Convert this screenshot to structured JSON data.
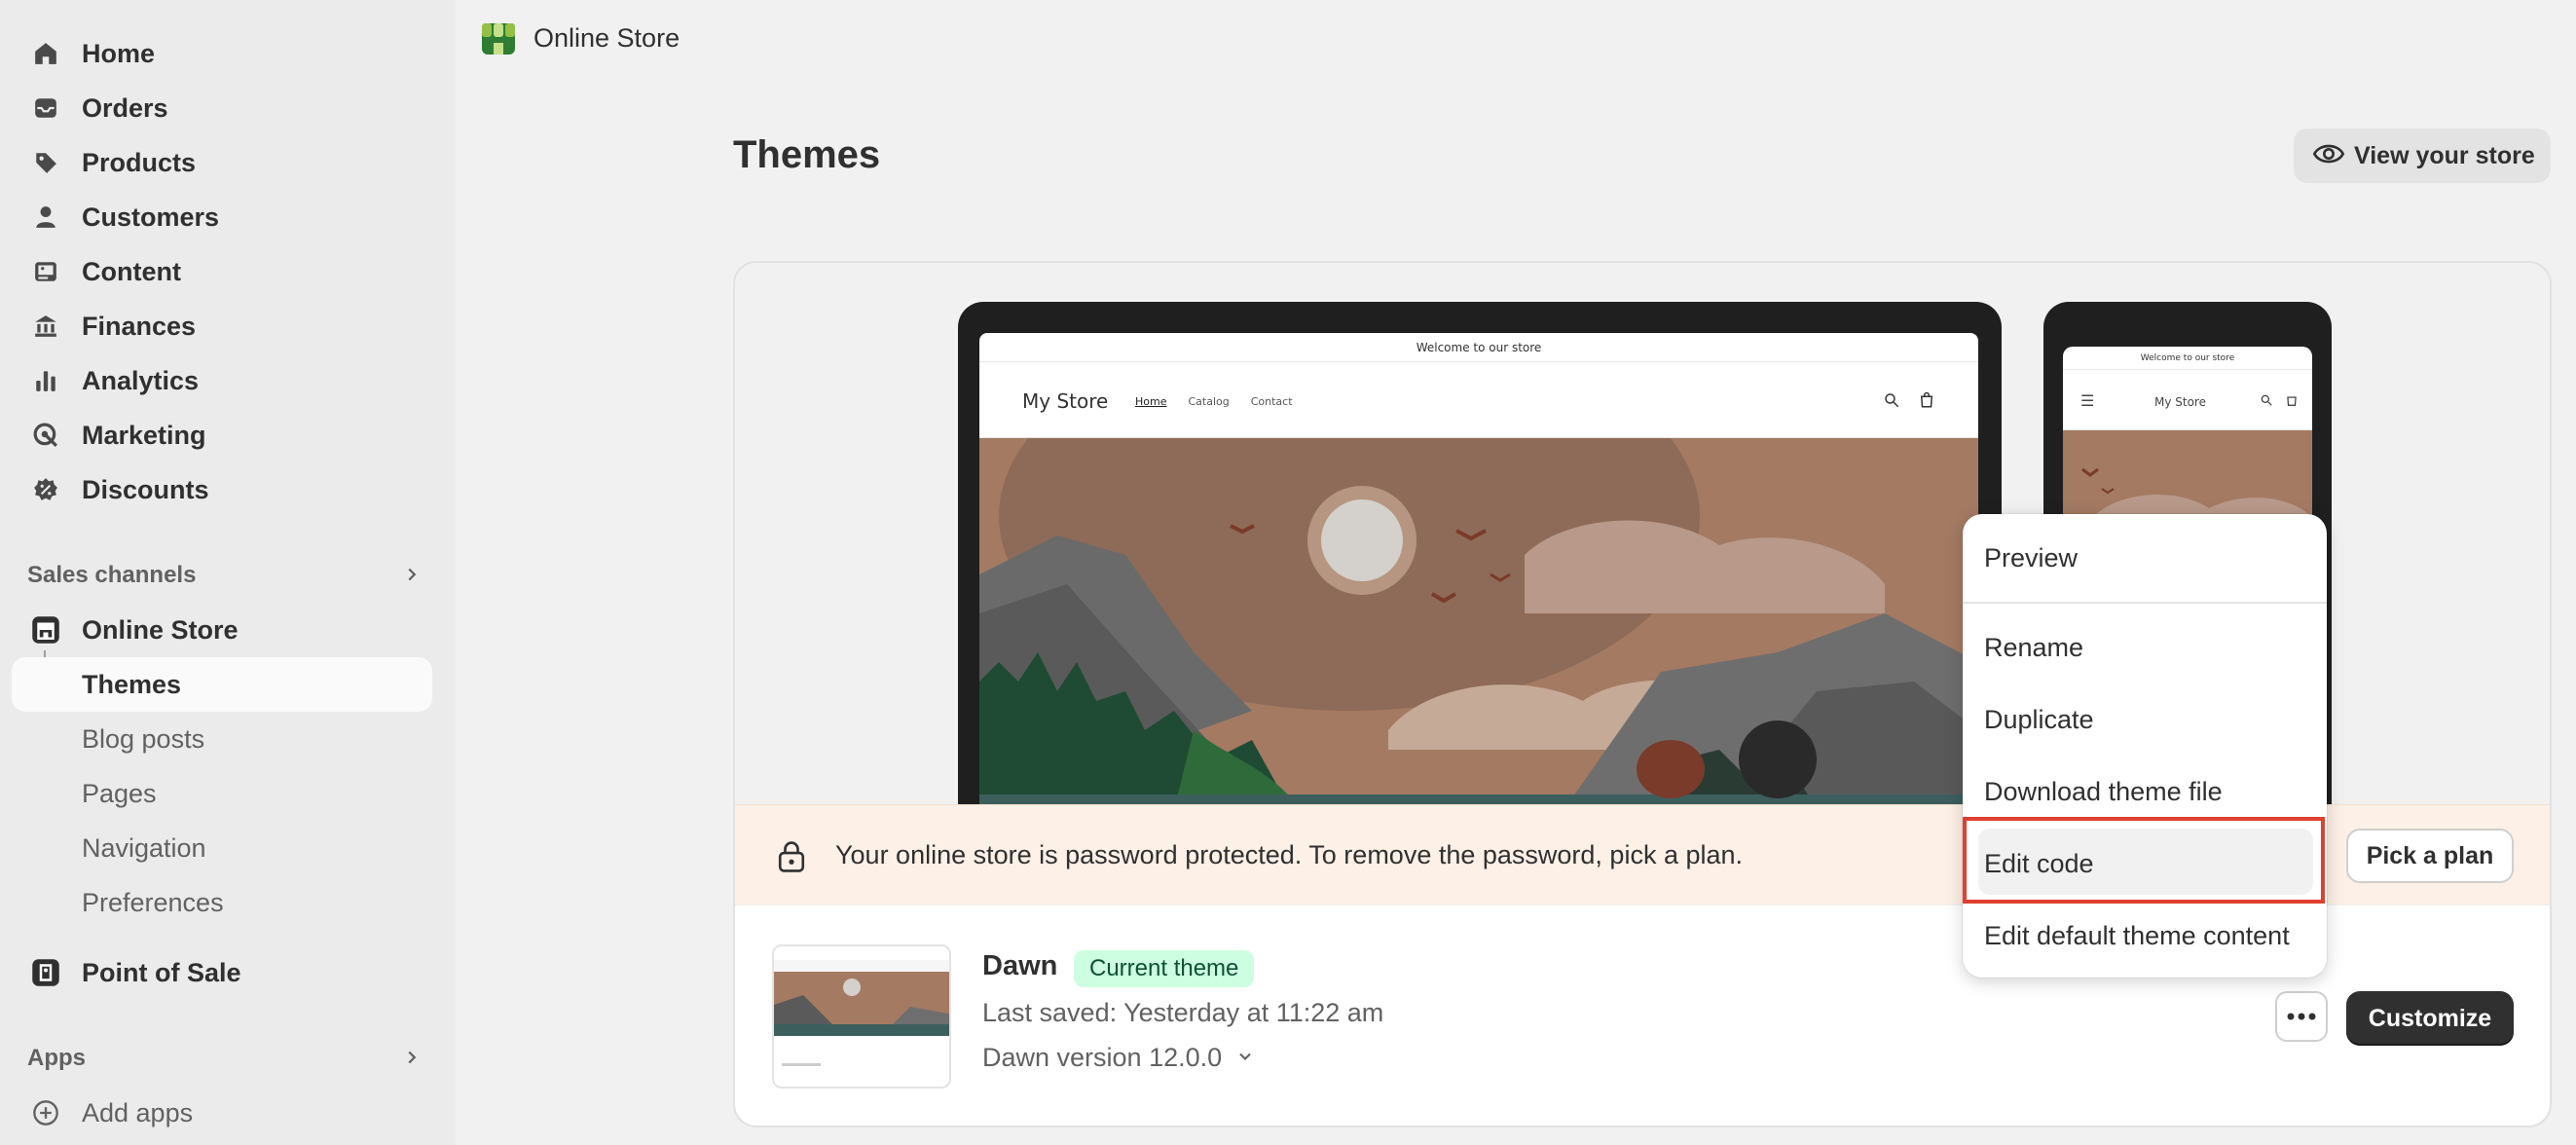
{
  "sidebar": {
    "main_items": [
      {
        "label": "Home",
        "icon": "home-icon"
      },
      {
        "label": "Orders",
        "icon": "inbox-icon"
      },
      {
        "label": "Products",
        "icon": "tag-icon"
      },
      {
        "label": "Customers",
        "icon": "person-icon"
      },
      {
        "label": "Content",
        "icon": "image-icon"
      },
      {
        "label": "Finances",
        "icon": "bank-icon"
      },
      {
        "label": "Analytics",
        "icon": "bar-chart-icon"
      },
      {
        "label": "Marketing",
        "icon": "target-icon"
      },
      {
        "label": "Discounts",
        "icon": "discount-icon"
      }
    ],
    "sales_channels_label": "Sales channels",
    "online_store_label": "Online Store",
    "sub_items": [
      {
        "label": "Themes",
        "active": true
      },
      {
        "label": "Blog posts"
      },
      {
        "label": "Pages"
      },
      {
        "label": "Navigation"
      },
      {
        "label": "Preferences"
      }
    ],
    "point_of_sale_label": "Point of Sale",
    "apps_label": "Apps",
    "add_apps_label": "Add apps"
  },
  "topbar": {
    "title": "Online Store"
  },
  "page": {
    "title": "Themes",
    "view_store_label": "View your store"
  },
  "preview": {
    "announcement": "Welcome to our store",
    "store_name": "My Store",
    "nav": [
      "Home",
      "Catalog",
      "Contact"
    ]
  },
  "banner": {
    "text": "Your online store is password protected. To remove the password, pick a plan.",
    "button_label": "Pick a plan"
  },
  "theme": {
    "name": "Dawn",
    "badge": "Current theme",
    "last_saved": "Last saved: Yesterday at 11:22 am",
    "version": "Dawn version 12.0.0",
    "customize_label": "Customize"
  },
  "menu": {
    "items": [
      "Preview",
      "Rename",
      "Duplicate",
      "Download theme file",
      "Edit code",
      "Edit default theme content"
    ],
    "highlighted": "Edit code"
  },
  "colors": {
    "highlight_border": "#e0402f",
    "badge_bg": "#cdfee1",
    "banner_bg": "#fdf0e6",
    "primary_button": "#303030"
  }
}
